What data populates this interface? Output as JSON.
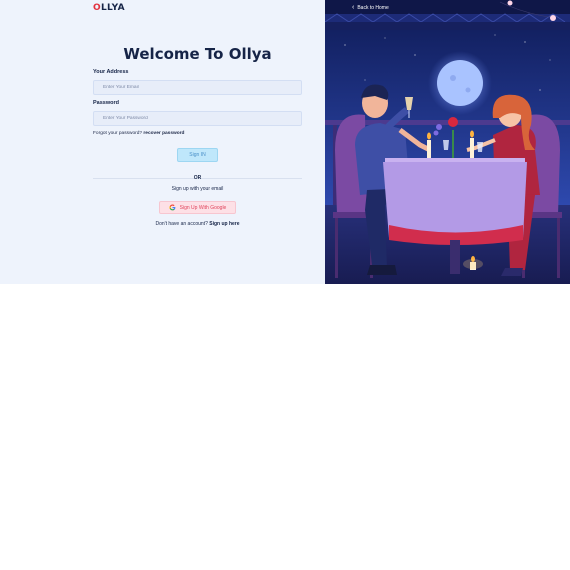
{
  "brand": {
    "logo_first": "O",
    "logo_rest": "LLYA"
  },
  "form": {
    "title": "Welcome To Ollya",
    "email_label": "Your Address",
    "email_placeholder": "Enter Your Email",
    "password_label": "Password",
    "password_placeholder": "Enter Your Password",
    "forgot_text": "Forgot your password?",
    "recover_link": "recover password",
    "signin_label": "Sign IN",
    "or_text": "OR",
    "signup_email_text": "Sign up with your email",
    "google_label": "Sign Up With Google",
    "no_account_text": "Don't have an account?",
    "signup_link": "Sign up here"
  },
  "hero": {
    "back_label": "Back to Home",
    "illustration": "romantic-dinner-illustration"
  },
  "colors": {
    "brand_red": "#e2313e",
    "navy": "#162447",
    "panel_bg": "#eef3fc",
    "signin_bg": "#bfe7fb",
    "google_bg": "#fde0e6"
  }
}
